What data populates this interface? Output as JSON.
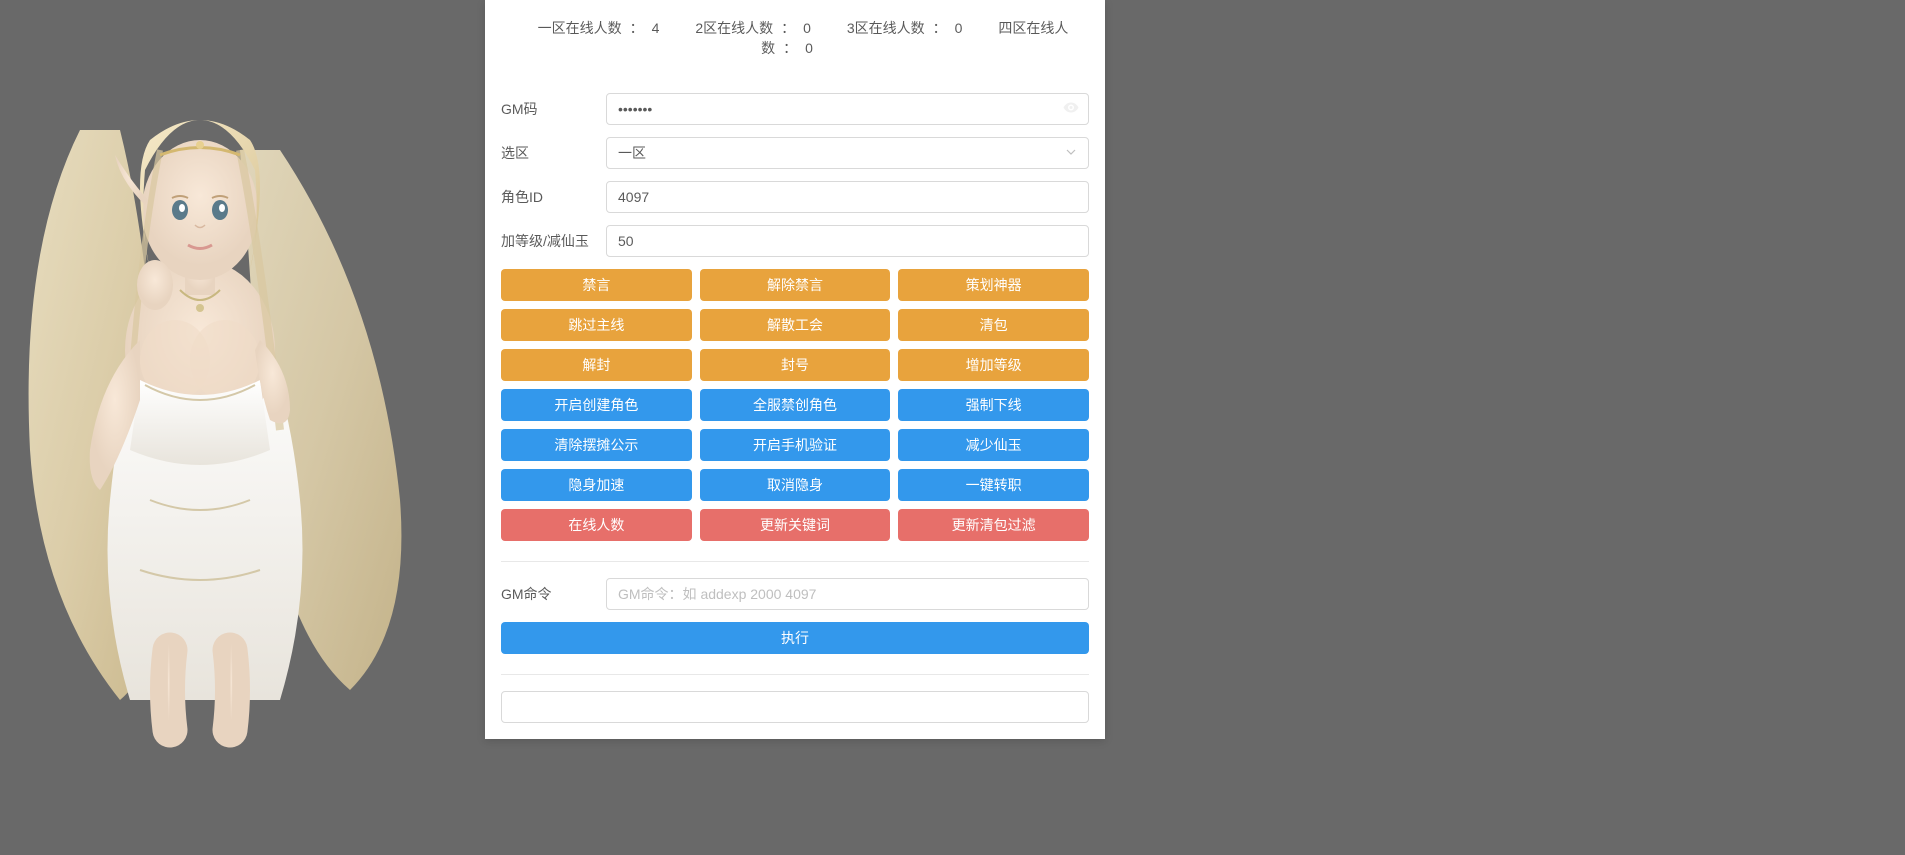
{
  "header": {
    "stats": [
      {
        "label": "一区在线人数",
        "value": "4"
      },
      {
        "label": "2区在线人数",
        "value": "0"
      },
      {
        "label": "3区在线人数",
        "value": "0"
      },
      {
        "label": "四区在线人数",
        "value": "0"
      }
    ]
  },
  "fields": {
    "gm_code": {
      "label": "GM码",
      "value": "•••••••"
    },
    "zone": {
      "label": "选区",
      "value": "一区"
    },
    "role_id": {
      "label": "角色ID",
      "value": "4097"
    },
    "level": {
      "label": "加等级/减仙玉",
      "value": "50"
    },
    "gm_cmd": {
      "label": "GM命令",
      "placeholder": "GM命令：如 addexp 2000 4097"
    }
  },
  "buttons": {
    "rows": [
      {
        "color": "orange",
        "items": [
          "禁言",
          "解除禁言",
          "策划神器"
        ]
      },
      {
        "color": "orange",
        "items": [
          "跳过主线",
          "解散工会",
          "清包"
        ]
      },
      {
        "color": "orange",
        "items": [
          "解封",
          "封号",
          "增加等级"
        ]
      },
      {
        "color": "blue",
        "items": [
          "开启创建角色",
          "全服禁创角色",
          "强制下线"
        ]
      },
      {
        "color": "blue",
        "items": [
          "清除摆摊公示",
          "开启手机验证",
          "减少仙玉"
        ]
      },
      {
        "color": "blue",
        "items": [
          "隐身加速",
          "取消隐身",
          "一键转职"
        ]
      },
      {
        "color": "red",
        "items": [
          "在线人数",
          "更新关键词",
          "更新清包过滤"
        ]
      }
    ],
    "execute": "执行"
  }
}
